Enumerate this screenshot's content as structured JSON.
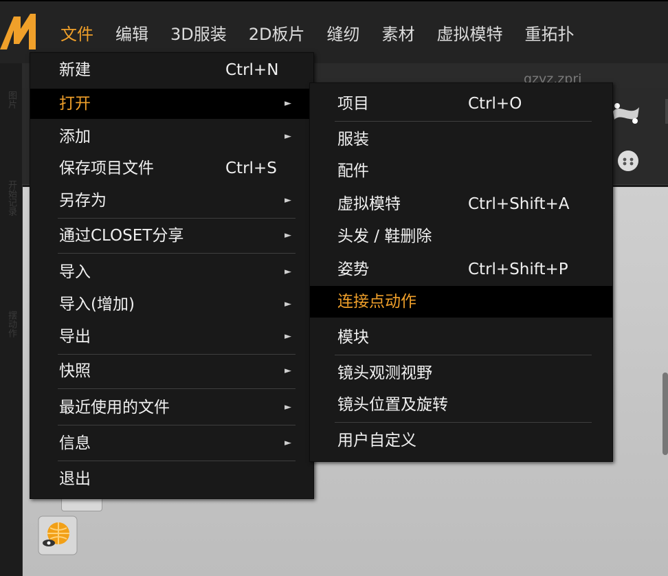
{
  "menubar": {
    "items": [
      {
        "label": "文件"
      },
      {
        "label": "编辑"
      },
      {
        "label": "3D服装"
      },
      {
        "label": "2D板片"
      },
      {
        "label": "缝纫"
      },
      {
        "label": "素材"
      },
      {
        "label": "虚拟模特"
      },
      {
        "label": "重拓扑"
      }
    ]
  },
  "document": {
    "title": "qzyz.zprj"
  },
  "left_strip": {
    "labels": [
      "图片",
      "开始记录",
      "摆动作"
    ]
  },
  "file_menu": {
    "items": [
      {
        "label": "新建",
        "shortcut": "Ctrl+N"
      },
      {
        "label": "打开",
        "submenu": true
      },
      {
        "label": "添加",
        "submenu": true
      },
      {
        "label": "保存项目文件",
        "shortcut": "Ctrl+S"
      },
      {
        "label": "另存为",
        "submenu": true
      },
      {
        "label": "通过CLOSET分享",
        "submenu": true
      },
      {
        "label": "导入",
        "submenu": true
      },
      {
        "label": "导入(增加)",
        "submenu": true
      },
      {
        "label": "导出",
        "submenu": true
      },
      {
        "label": "快照",
        "submenu": true
      },
      {
        "label": "最近使用的文件",
        "submenu": true
      },
      {
        "label": "信息",
        "submenu": true
      },
      {
        "label": "退出"
      }
    ],
    "arrow": "►"
  },
  "open_submenu": {
    "items": [
      {
        "label": "项目",
        "shortcut": "Ctrl+O"
      },
      {
        "label": "服装"
      },
      {
        "label": "配件"
      },
      {
        "label": "虚拟模特",
        "shortcut": "Ctrl+Shift+A"
      },
      {
        "label": "头发 / 鞋删除"
      },
      {
        "label": "姿势",
        "shortcut": "Ctrl+Shift+P"
      },
      {
        "label": "连接点动作"
      },
      {
        "label": "模块"
      },
      {
        "label": "镜头观测视野"
      },
      {
        "label": "镜头位置及旋转"
      },
      {
        "label": "用户自定义"
      }
    ]
  },
  "colors": {
    "accent": "#f0a02a",
    "menu_bg": "#191919"
  },
  "icons": [
    "logo-icon",
    "fabric-tool-icon",
    "button-tool-icon",
    "avatar-icon",
    "globe-eye-icon"
  ]
}
